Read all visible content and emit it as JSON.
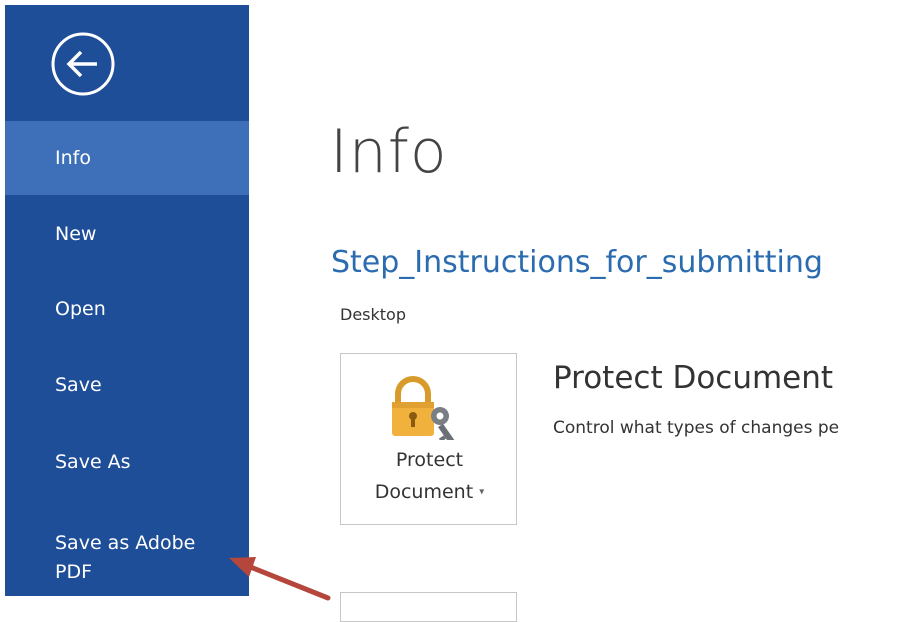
{
  "sidebar": {
    "items": [
      {
        "label": "Info",
        "active": true
      },
      {
        "label": "New"
      },
      {
        "label": "Open"
      },
      {
        "label": "Save"
      },
      {
        "label": "Save As"
      },
      {
        "label": "Save as Adobe PDF"
      }
    ]
  },
  "main": {
    "title": "Info",
    "document_name": "Step_Instructions_for_submitting",
    "location": "Desktop",
    "protect": {
      "button_label_line1": "Protect",
      "button_label_line2": "Document",
      "section_title": "Protect Document",
      "section_description": "Control what types of changes pe"
    }
  },
  "colors": {
    "sidebar_bg": "#1f4e98",
    "sidebar_active": "#3e6fb9",
    "doc_name": "#2b6cb0",
    "annotation_arrow": "#b5463b"
  },
  "icons": {
    "back": "back-arrow-circle-icon",
    "protect": "lock-key-icon"
  }
}
